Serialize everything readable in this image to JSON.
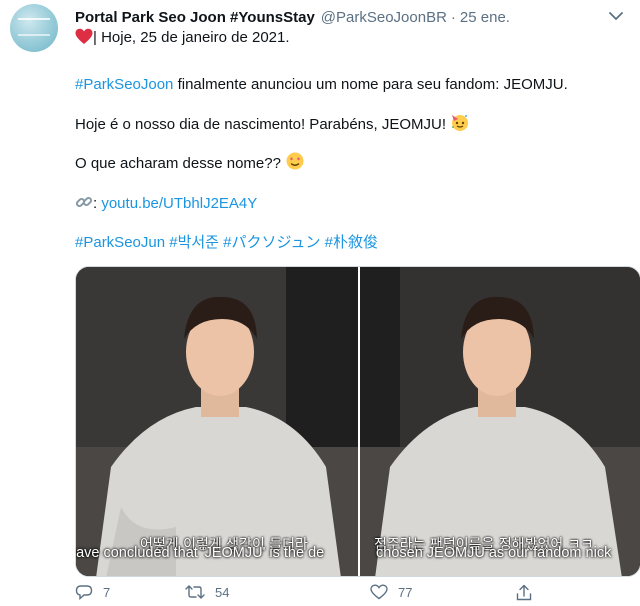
{
  "tweet": {
    "display_name": "Portal Park Seo Joon #YounsStay",
    "handle": "@ParkSeoJoonBR",
    "dot": "·",
    "time": "25 ene.",
    "line1_text": "| Hoje, 25 de janeiro de 2021.",
    "line2_hashtag": "#ParkSeoJoon",
    "line2_text": " finalmente anunciou um nome para seu fandom: JEOMJU.",
    "line3_text": "Hoje é o nosso dia de nascimento! Parabéns, JEOMJU! ",
    "line4_text": "O que acharam desse nome?? ",
    "line5_prefix": ": ",
    "line5_link": "youtu.be/UTbhlJ2EA4Y",
    "hashtags": [
      "#ParkSeoJun",
      "#박서준",
      "#パクソジュン",
      "#朴敘俊"
    ],
    "icons": {
      "heart": "heart-emoji",
      "party": "party-face-emoji",
      "face": "star-struck-face-emoji",
      "link": "link-emoji",
      "more": "more-options-icon"
    }
  },
  "media": {
    "left_subtitle_kr": "어떻게 이렇게 생각이 들더라",
    "left_subtitle_en": "have concluded that 'JEOMJU' is the de",
    "right_subtitle_kr": "점주라는 팬덤이름을 정해봤었어 ㅋㅋ",
    "right_subtitle_en": "chosen JEOMJU as our fandom nick"
  },
  "actions": {
    "reply_count": "7",
    "retweet_count": "54",
    "like_count": "77"
  },
  "colors": {
    "link": "#1b95e0",
    "secondary": "#5b7083",
    "text": "#0f1419",
    "heart": "#e0245e"
  }
}
